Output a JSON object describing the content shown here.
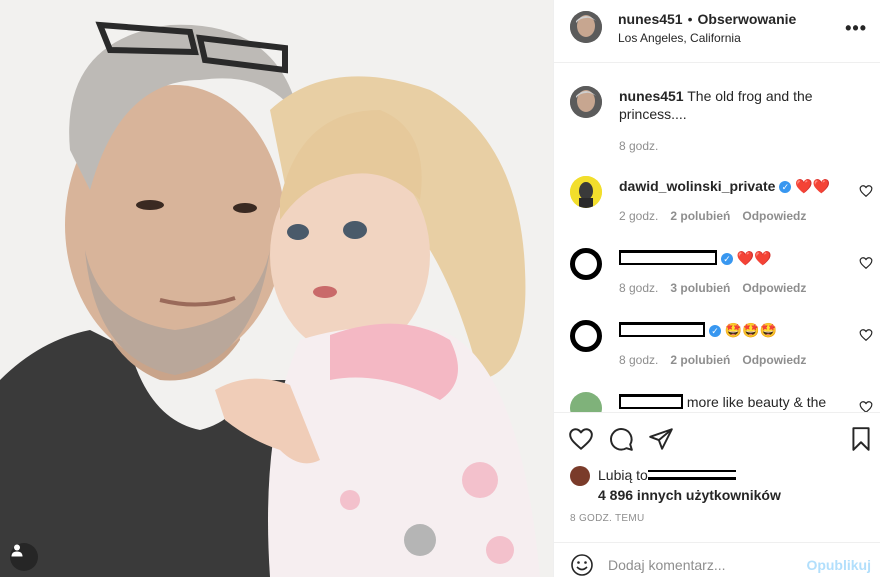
{
  "post": {
    "username": "nunes451",
    "separator": "•",
    "follow_label": "Obserwowanie",
    "location": "Los Angeles, California",
    "more_icon": "more-horizontal-icon"
  },
  "comments": [
    {
      "username": "nunes451",
      "text": "The old frog and the princess....",
      "time": "8 godz."
    },
    {
      "username": "dawid_wolinski_private",
      "verified": true,
      "text": "❤️❤️",
      "time": "2 godz.",
      "likes": "2 polubień",
      "reply": "Odpowiedz"
    },
    {
      "username": "",
      "verified": true,
      "text": "❤️❤️",
      "time": "8 godz.",
      "likes": "3 polubień",
      "reply": "Odpowiedz"
    },
    {
      "username": "",
      "verified": true,
      "text": "🤩🤩🤩",
      "time": "8 godz.",
      "likes": "2 polubień",
      "reply": "Odpowiedz"
    },
    {
      "username": "",
      "text": "more like beauty & the"
    }
  ],
  "likes": {
    "line1_prefix": "Lubią to",
    "line2": "4 896 innych użytkowników"
  },
  "time_ago": "8 GODZ. TEMU",
  "add_comment": {
    "placeholder": "Dodaj komentarz...",
    "publish_label": "Opublikuj"
  },
  "colors": {
    "accent_blue": "#3897f0",
    "publish_disabled": "#b2dffc",
    "heart_red": "#ed4956",
    "muted": "#8e8e8e"
  }
}
